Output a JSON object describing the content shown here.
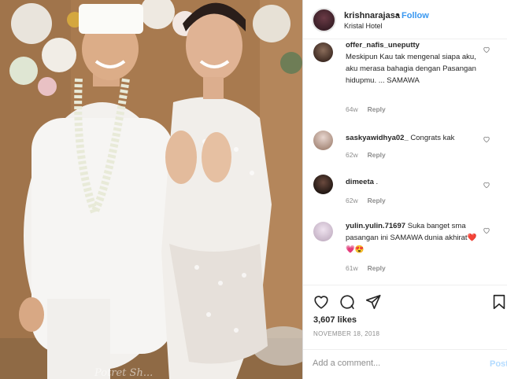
{
  "post": {
    "photo_caption": "Potret Sh...",
    "header": {
      "username": "krishnarajasa",
      "separator": "•",
      "follow_label": "Follow",
      "location": "Kristal Hotel"
    },
    "comments": [
      {
        "username": "offer_nafis_uneputty",
        "text": "Meskipun Kau tak mengenal siapa aku, aku merasa bahagia dengan Pasangan hidupmu. ... SAMAWA",
        "time": "64w",
        "reply_label": "Reply"
      },
      {
        "username": "saskyawidhya02_",
        "text": "Congrats kak",
        "time": "62w",
        "reply_label": "Reply"
      },
      {
        "username": "dimeeta",
        "text": ".",
        "time": "62w",
        "reply_label": "Reply"
      },
      {
        "username": "yulin.yulin.71697",
        "text": "Suka banget sma pasangan ini SAMAWA dunia akhirat❤️💗😍",
        "time": "61w",
        "reply_label": "Reply"
      }
    ],
    "likes": "3,607 likes",
    "date": "NOVEMBER 18, 2018",
    "add_comment_placeholder": "Add a comment...",
    "post_label": "Post"
  },
  "icons": {
    "like": "heart-icon",
    "comment": "comment-bubble-icon",
    "share": "paper-plane-icon",
    "save": "bookmark-icon",
    "comment_like": "small-heart-icon"
  },
  "colors": {
    "accent": "#3897f0",
    "post_disabled": "#b3dbff",
    "muted": "#8e8e8e"
  }
}
